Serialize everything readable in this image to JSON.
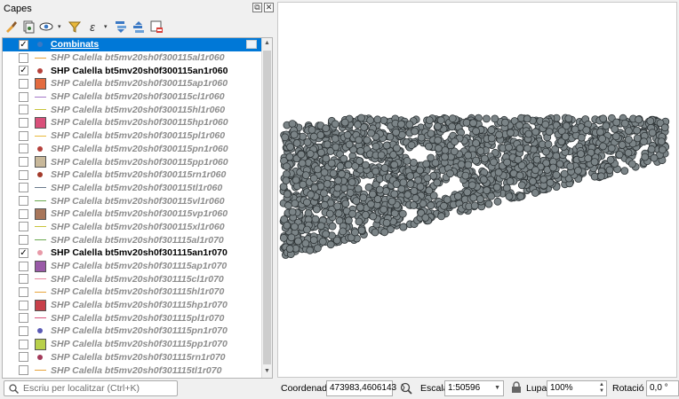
{
  "panel": {
    "title": "Capes",
    "float_btn": "⧉",
    "close_btn": "✕"
  },
  "toolbar": {
    "icons": [
      "style-brush-icon",
      "add-group-icon",
      "eye-visibility-icon",
      "filter-icon",
      "expression-filter-icon",
      "expand-all-icon",
      "collapse-all-icon",
      "remove-layer-icon"
    ],
    "expr_label": "ε"
  },
  "layers": [
    {
      "name": "Combinats",
      "checked": true,
      "selected": true,
      "symbol": "dot",
      "color": "#3a78c4",
      "active": true
    },
    {
      "name": "SHP Calella bt5mv20sh0f300115al1r060",
      "checked": false,
      "symbol": "line",
      "color": "#e8a33a",
      "active": false
    },
    {
      "name": "SHP Calella bt5mv20sh0f300115an1r060",
      "checked": true,
      "symbol": "dot",
      "color": "#b5413b",
      "active": true
    },
    {
      "name": "SHP Calella bt5mv20sh0f300115ap1r060",
      "checked": false,
      "symbol": "square",
      "color": "#e36b3f",
      "active": false
    },
    {
      "name": "SHP Calella bt5mv20sh0f300115cl1r060",
      "checked": false,
      "symbol": "line",
      "color": "#a478c8",
      "active": false
    },
    {
      "name": "SHP Calella bt5mv20sh0f300115hl1r060",
      "checked": false,
      "symbol": "line",
      "color": "#c8c43a",
      "active": false
    },
    {
      "name": "SHP Calella bt5mv20sh0f300115hp1r060",
      "checked": false,
      "symbol": "square",
      "color": "#d9507a",
      "active": false
    },
    {
      "name": "SHP Calella bt5mv20sh0f300115pl1r060",
      "checked": false,
      "symbol": "line",
      "color": "#e8b83a",
      "active": false
    },
    {
      "name": "SHP Calella bt5mv20sh0f300115pn1r060",
      "checked": false,
      "symbol": "dot",
      "color": "#b5413b",
      "active": false
    },
    {
      "name": "SHP Calella bt5mv20sh0f300115pp1r060",
      "checked": false,
      "symbol": "square",
      "color": "#c8b89a",
      "active": false
    },
    {
      "name": "SHP Calella bt5mv20sh0f300115rn1r060",
      "checked": false,
      "symbol": "dot",
      "color": "#a33a2a",
      "active": false
    },
    {
      "name": "SHP Calella bt5mv20sh0f300115tl1r060",
      "checked": false,
      "symbol": "line",
      "color": "#6a7a8c",
      "active": false
    },
    {
      "name": "SHP Calella bt5mv20sh0f300115vl1r060",
      "checked": false,
      "symbol": "line",
      "color": "#6aa84f",
      "active": false
    },
    {
      "name": "SHP Calella bt5mv20sh0f300115vp1r060",
      "checked": false,
      "symbol": "square",
      "color": "#a8765a",
      "active": false
    },
    {
      "name": "SHP Calella bt5mv20sh0f300115xl1r060",
      "checked": false,
      "symbol": "line",
      "color": "#c8c43a",
      "active": false
    },
    {
      "name": "SHP Calella bt5mv20sh0f301115al1r070",
      "checked": false,
      "symbol": "line",
      "color": "#6aa84f",
      "active": false
    },
    {
      "name": "SHP Calella bt5mv20sh0f301115an1r070",
      "checked": true,
      "symbol": "dot",
      "color": "#e89aa8",
      "active": true
    },
    {
      "name": "SHP Calella bt5mv20sh0f301115ap1r070",
      "checked": false,
      "symbol": "square",
      "color": "#9a5aa8",
      "active": false
    },
    {
      "name": "SHP Calella bt5mv20sh0f301115cl1r070",
      "checked": false,
      "symbol": "line",
      "color": "#e88aa0",
      "active": false
    },
    {
      "name": "SHP Calella bt5mv20sh0f301115hl1r070",
      "checked": false,
      "symbol": "line",
      "color": "#e8a33a",
      "active": false
    },
    {
      "name": "SHP Calella bt5mv20sh0f301115hp1r070",
      "checked": false,
      "symbol": "square",
      "color": "#c8404a",
      "active": false
    },
    {
      "name": "SHP Calella bt5mv20sh0f301115pl1r070",
      "checked": false,
      "symbol": "line",
      "color": "#d9507a",
      "active": false
    },
    {
      "name": "SHP Calella bt5mv20sh0f301115pn1r070",
      "checked": false,
      "symbol": "dot",
      "color": "#5a5ab5",
      "active": false
    },
    {
      "name": "SHP Calella bt5mv20sh0f301115pp1r070",
      "checked": false,
      "symbol": "square",
      "color": "#b8d04a",
      "active": false
    },
    {
      "name": "SHP Calella bt5mv20sh0f301115rn1r070",
      "checked": false,
      "symbol": "dot",
      "color": "#a33a5a",
      "active": false
    },
    {
      "name": "SHP Calella bt5mv20sh0f301115tl1r070",
      "checked": false,
      "symbol": "line",
      "color": "#e8a33a",
      "active": false
    }
  ],
  "map": {
    "point_fill": "#7b8487",
    "point_stroke": "#2e3436"
  },
  "status": {
    "search_placeholder": "Escriu per localitzar (Ctrl+K)",
    "coord_label": "Coordenada",
    "coord_value": "473983,4606143",
    "scale_label": "Escala",
    "scale_value": "1:50596",
    "magnifier_label": "Lupa",
    "magnifier_value": "100%",
    "rotation_label": "Rotació",
    "rotation_value": "0,0 °"
  }
}
